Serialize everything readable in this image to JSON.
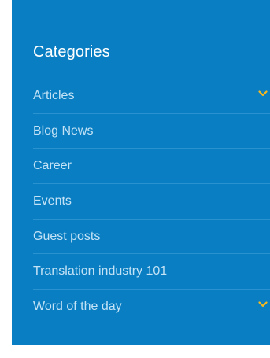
{
  "sidebar": {
    "title": "Categories",
    "accent_color": "#f5b820",
    "items": [
      {
        "label": "Articles",
        "has_submenu": true,
        "icon": "chevron-down-icon"
      },
      {
        "label": "Blog News",
        "has_submenu": false
      },
      {
        "label": "Career",
        "has_submenu": false
      },
      {
        "label": "Events",
        "has_submenu": false
      },
      {
        "label": "Guest posts",
        "has_submenu": false
      },
      {
        "label": "Translation industry 101",
        "has_submenu": false
      },
      {
        "label": "Word of the day",
        "has_submenu": true,
        "icon": "chevron-down-icon"
      }
    ]
  }
}
